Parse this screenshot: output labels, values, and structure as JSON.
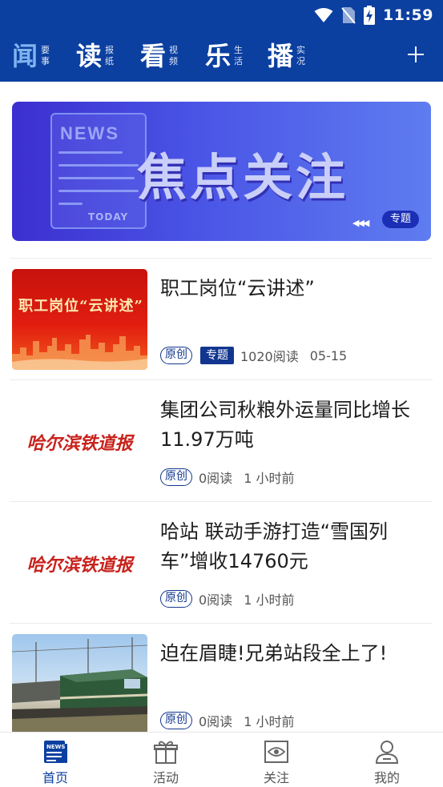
{
  "status_bar": {
    "time": "11:59"
  },
  "top_nav": {
    "categories": [
      {
        "char": "闻",
        "sub_1": "要",
        "sub_2": "事"
      },
      {
        "char": "读",
        "sub_1": "报",
        "sub_2": "纸"
      },
      {
        "char": "看",
        "sub_1": "视",
        "sub_2": "频"
      },
      {
        "char": "乐",
        "sub_1": "生",
        "sub_2": "活"
      },
      {
        "char": "播",
        "sub_1": "实",
        "sub_2": "况"
      }
    ],
    "active_index": 0
  },
  "banner": {
    "news_text": "NEWS",
    "today_text": "TODAY",
    "title": "焦点关注",
    "arrows": "◀◀◀",
    "tag": "专题"
  },
  "articles": [
    {
      "title": "职工岗位“云讲述”",
      "thumb_text": "职工岗位“云讲述”",
      "badge_original": "原创",
      "badge_topic": "专题",
      "reads": "1020阅读",
      "time": "05-15"
    },
    {
      "title": "集团公司秋粮外运量同比增长11.97万吨",
      "thumb_text": "哈尔滨铁道报",
      "badge_original": "原创",
      "reads": "0阅读",
      "time": "1 小时前"
    },
    {
      "title": "哈站 联动手游打造“雪国列车”增收14760元",
      "thumb_text": "哈尔滨铁道报",
      "badge_original": "原创",
      "reads": "0阅读",
      "time": "1 小时前"
    },
    {
      "title": "迫在眉睫!兄弟站段全上了!",
      "badge_original": "原创",
      "reads": "0阅读",
      "time": "1 小时前"
    }
  ],
  "tab_bar": {
    "tabs": [
      {
        "label": "首页",
        "icon": "newspaper-icon"
      },
      {
        "label": "活动",
        "icon": "gift-icon"
      },
      {
        "label": "关注",
        "icon": "eye-icon"
      },
      {
        "label": "我的",
        "icon": "user-icon"
      }
    ],
    "active_index": 0
  },
  "colors": {
    "brand_blue": "#0b3fa0",
    "active_nav": "#7fb4f0",
    "badge_blue": "#12368f",
    "banner_purple": "#4a55e6"
  }
}
